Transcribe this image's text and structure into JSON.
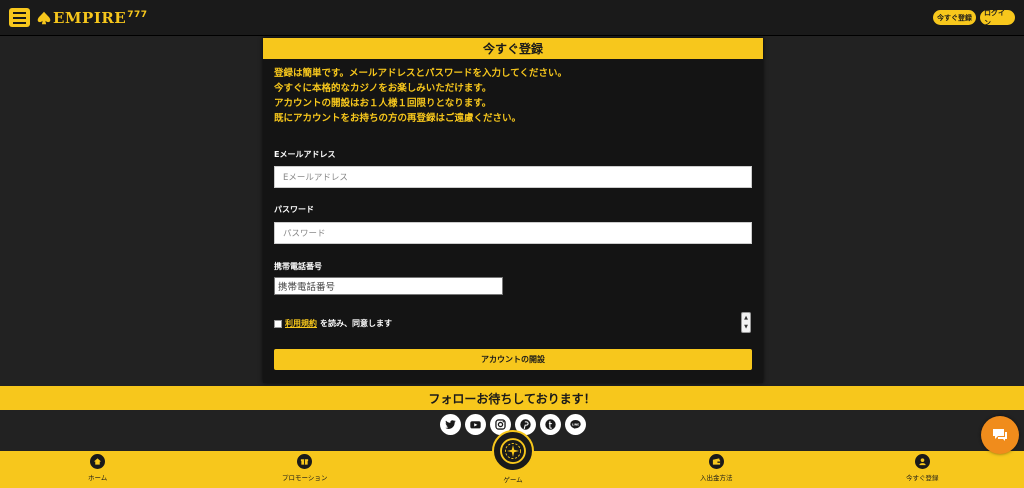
{
  "header": {
    "logo_text": "EMPIRE",
    "logo_suffix": "777",
    "register_label": "今すぐ登録",
    "login_label": "ログイン"
  },
  "registration": {
    "title": "今すぐ登録",
    "intro_lines": [
      "登録は簡単です。メールアドレスとパスワードを入力してください。",
      "今すぐに本格的なカジノをお楽しみいただけます。",
      "アカウントの開設はお１人様１回限りとなります。",
      "既にアカウントをお持ちの方の再登録はご遠慮ください。"
    ],
    "email_label": "Eメールアドレス",
    "email_placeholder": "Eメールアドレス",
    "password_label": "パスワード",
    "password_placeholder": "パスワード",
    "phone_label": "携帯電話番号",
    "phone_placeholder": "携帯電話番号",
    "terms_link": "利用規約",
    "terms_text": "を読み、同意します",
    "submit_label": "アカウントの開設"
  },
  "follow": {
    "text": "フォローお待ちしております！",
    "social_icons": [
      "twitter-icon",
      "youtube-icon",
      "instagram-icon",
      "pinterest-icon",
      "tumblr-icon",
      "line-icon"
    ]
  },
  "bottom_nav": {
    "home": "ホーム",
    "promotion": "プロモーション",
    "game": "ゲーム",
    "deposit": "入出金方法",
    "register": "今すぐ登録"
  },
  "colors": {
    "accent": "#f7c71c",
    "background": "#222222",
    "panel": "#141414",
    "chat": "#f08c1c"
  }
}
